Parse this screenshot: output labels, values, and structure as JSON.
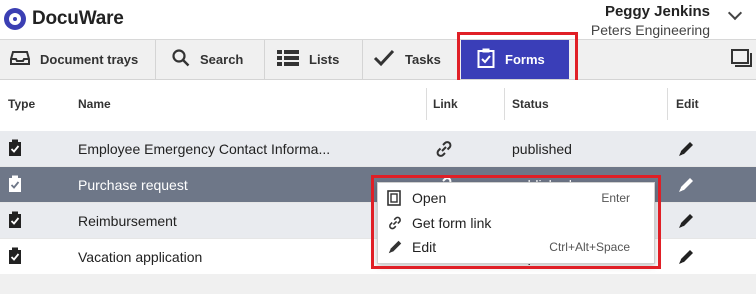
{
  "app": {
    "logo_text": "DocuWare",
    "user_name": "Peggy Jenkins",
    "user_org": "Peters Engineering"
  },
  "nav": {
    "tabs": [
      {
        "label": "Document trays",
        "icon": "tray-icon"
      },
      {
        "label": "Search",
        "icon": "search-icon"
      },
      {
        "label": "Lists",
        "icon": "list-icon"
      },
      {
        "label": "Tasks",
        "icon": "checkmark-icon"
      },
      {
        "label": "Forms",
        "icon": "form-clipboard-icon",
        "active": true
      }
    ]
  },
  "table": {
    "headers": {
      "type": "Type",
      "name": "Name",
      "link": "Link",
      "status": "Status",
      "edit": "Edit"
    },
    "rows": [
      {
        "name": "Employee Emergency Contact Informa...",
        "status": "published"
      },
      {
        "name": "Purchase request",
        "status": "published"
      },
      {
        "name": "Reimbursement",
        "status": ""
      },
      {
        "name": "Vacation application",
        "status": "unpublished"
      }
    ]
  },
  "context_menu": {
    "items": [
      {
        "label": "Open",
        "shortcut": "Enter",
        "icon": "open-icon"
      },
      {
        "label": "Get form link",
        "shortcut": "",
        "icon": "link-icon"
      },
      {
        "label": "Edit",
        "shortcut": "Ctrl+Alt+Space",
        "icon": "pencil-icon"
      }
    ]
  },
  "colors": {
    "accent": "#3a3eb8",
    "highlight_outline": "#e01f26",
    "selected_row": "#6e7788"
  }
}
